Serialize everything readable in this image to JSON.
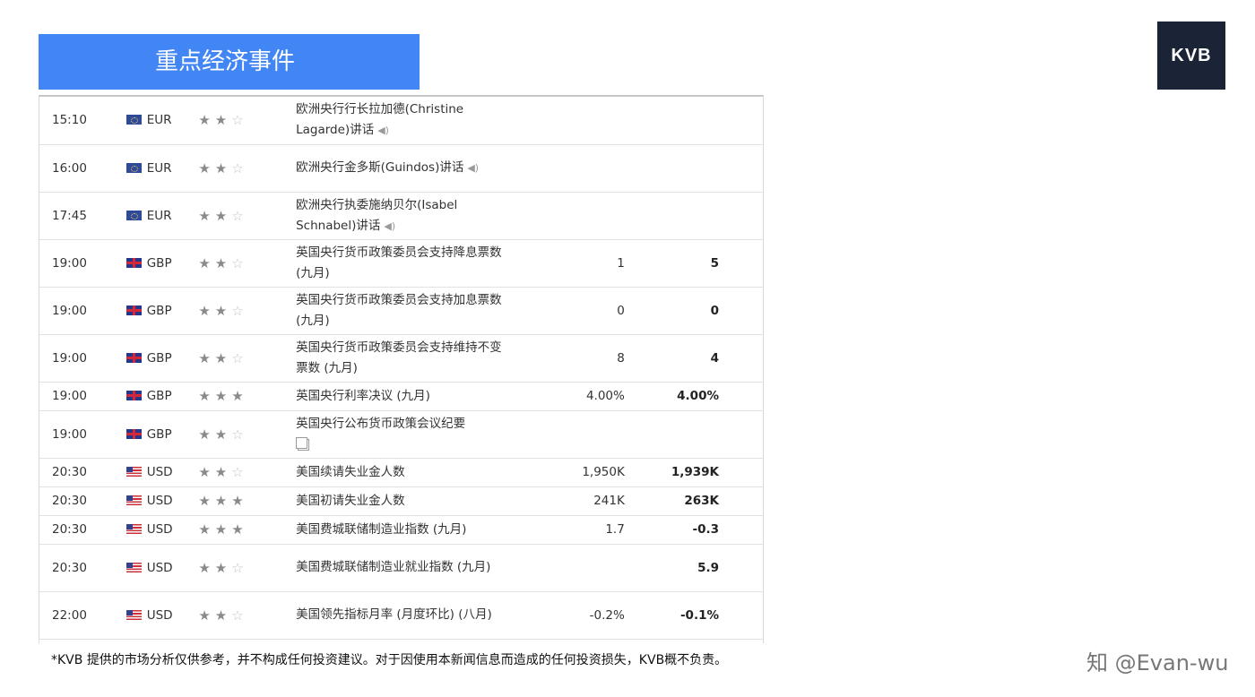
{
  "header": {
    "title": "重点经济事件",
    "logo_text": "KVB"
  },
  "rows": [
    {
      "time": "15:10",
      "flag": "eu",
      "currency": "EUR",
      "stars": 2,
      "event": "欧洲央行行长拉加德(Christine Lagarde)讲话",
      "icon": "speaker",
      "actual": "",
      "forecast": ""
    },
    {
      "time": "16:00",
      "flag": "eu",
      "currency": "EUR",
      "stars": 2,
      "event": "欧洲央行金多斯(Guindos)讲话",
      "icon": "speaker",
      "actual": "",
      "forecast": ""
    },
    {
      "time": "17:45",
      "flag": "eu",
      "currency": "EUR",
      "stars": 2,
      "event": "欧洲央行执委施纳贝尔(Isabel Schnabel)讲话",
      "icon": "speaker",
      "actual": "",
      "forecast": ""
    },
    {
      "time": "19:00",
      "flag": "gb",
      "currency": "GBP",
      "stars": 2,
      "event": "英国央行货币政策委员会支持降息票数 (九月)",
      "icon": "",
      "actual": "1",
      "forecast": "5"
    },
    {
      "time": "19:00",
      "flag": "gb",
      "currency": "GBP",
      "stars": 2,
      "event": "英国央行货币政策委员会支持加息票数 (九月)",
      "icon": "",
      "actual": "0",
      "forecast": "0"
    },
    {
      "time": "19:00",
      "flag": "gb",
      "currency": "GBP",
      "stars": 2,
      "event": "英国央行货币政策委员会支持维持不变票数 (九月)",
      "icon": "",
      "actual": "8",
      "forecast": "4"
    },
    {
      "time": "19:00",
      "flag": "gb",
      "currency": "GBP",
      "stars": 3,
      "event": "英国央行利率决议 (九月)",
      "icon": "",
      "actual": "4.00%",
      "forecast": "4.00%"
    },
    {
      "time": "19:00",
      "flag": "gb",
      "currency": "GBP",
      "stars": 2,
      "event": "英国央行公布货币政策会议纪要",
      "icon": "document",
      "actual": "",
      "forecast": ""
    },
    {
      "time": "20:30",
      "flag": "us",
      "currency": "USD",
      "stars": 2,
      "event": "美国续请失业金人数",
      "icon": "",
      "actual": "1,950K",
      "forecast": "1,939K"
    },
    {
      "time": "20:30",
      "flag": "us",
      "currency": "USD",
      "stars": 3,
      "event": "美国初请失业金人数",
      "icon": "",
      "actual": "241K",
      "forecast": "263K"
    },
    {
      "time": "20:30",
      "flag": "us",
      "currency": "USD",
      "stars": 3,
      "event": "美国费城联储制造业指数 (九月)",
      "icon": "",
      "actual": "1.7",
      "forecast": "-0.3"
    },
    {
      "time": "20:30",
      "flag": "us",
      "currency": "USD",
      "stars": 2,
      "event": "美国费城联储制造业就业指数 (九月)",
      "icon": "",
      "actual": "",
      "forecast": "5.9"
    },
    {
      "time": "22:00",
      "flag": "us",
      "currency": "USD",
      "stars": 2,
      "event": "美国领先指标月率 (月度环比) (八月)",
      "icon": "",
      "actual": "-0.2%",
      "forecast": "-0.1%"
    }
  ],
  "footer": {
    "disclaimer": "*KVB 提供的市场分析仅供参考，并不构成任何投资建议。对于因使用本新闻信息而造成的任何投资损失，KVB概不负责。"
  },
  "watermark": {
    "text": "知 @Evan-wu"
  },
  "colors": {
    "banner": "#4285f4",
    "logo_bg": "#1b2436",
    "star_on": "#8a8a8a",
    "star_off": "#c4c4c4"
  }
}
